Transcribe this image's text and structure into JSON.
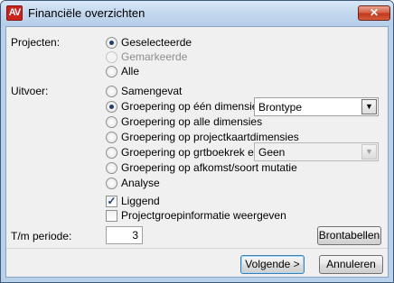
{
  "window": {
    "title": "Financiële overzichten",
    "icon": "app-logo-icon"
  },
  "close_label": "✕",
  "projecten": {
    "label": "Projecten:",
    "options": [
      {
        "label": "Geselecteerde",
        "checked": true,
        "disabled": false
      },
      {
        "label": "Gemarkeerde",
        "checked": false,
        "disabled": true
      },
      {
        "label": "Alle",
        "checked": false,
        "disabled": false
      }
    ]
  },
  "uitvoer": {
    "label": "Uitvoer:",
    "options": [
      {
        "label": "Samengevat",
        "checked": false
      },
      {
        "label": "Groepering op één dimensie",
        "checked": true
      },
      {
        "label": "Groepering op alle dimensies",
        "checked": false
      },
      {
        "label": "Groepering op projectkaartdimensies",
        "checked": false
      },
      {
        "label": "Groepering op grtboekrek en",
        "checked": false
      },
      {
        "label": "Groepering op afkomst/soort mutatie",
        "checked": false
      },
      {
        "label": "Analyse",
        "checked": false
      }
    ],
    "dimension_select": {
      "value": "Brontype"
    },
    "grtboek_select": {
      "value": "Geen"
    }
  },
  "checks": {
    "liggend": {
      "label": "Liggend",
      "checked": true
    },
    "projectgroep": {
      "label": "Projectgroepinformatie weergeven",
      "checked": false
    }
  },
  "periode": {
    "label": "T/m periode:",
    "value": "3"
  },
  "buttons": {
    "brontabellen": "Brontabellen",
    "volgende": "Volgende >",
    "annuleren": "Annuleren"
  },
  "check_glyph": "✓",
  "arrow_glyph": "▼"
}
